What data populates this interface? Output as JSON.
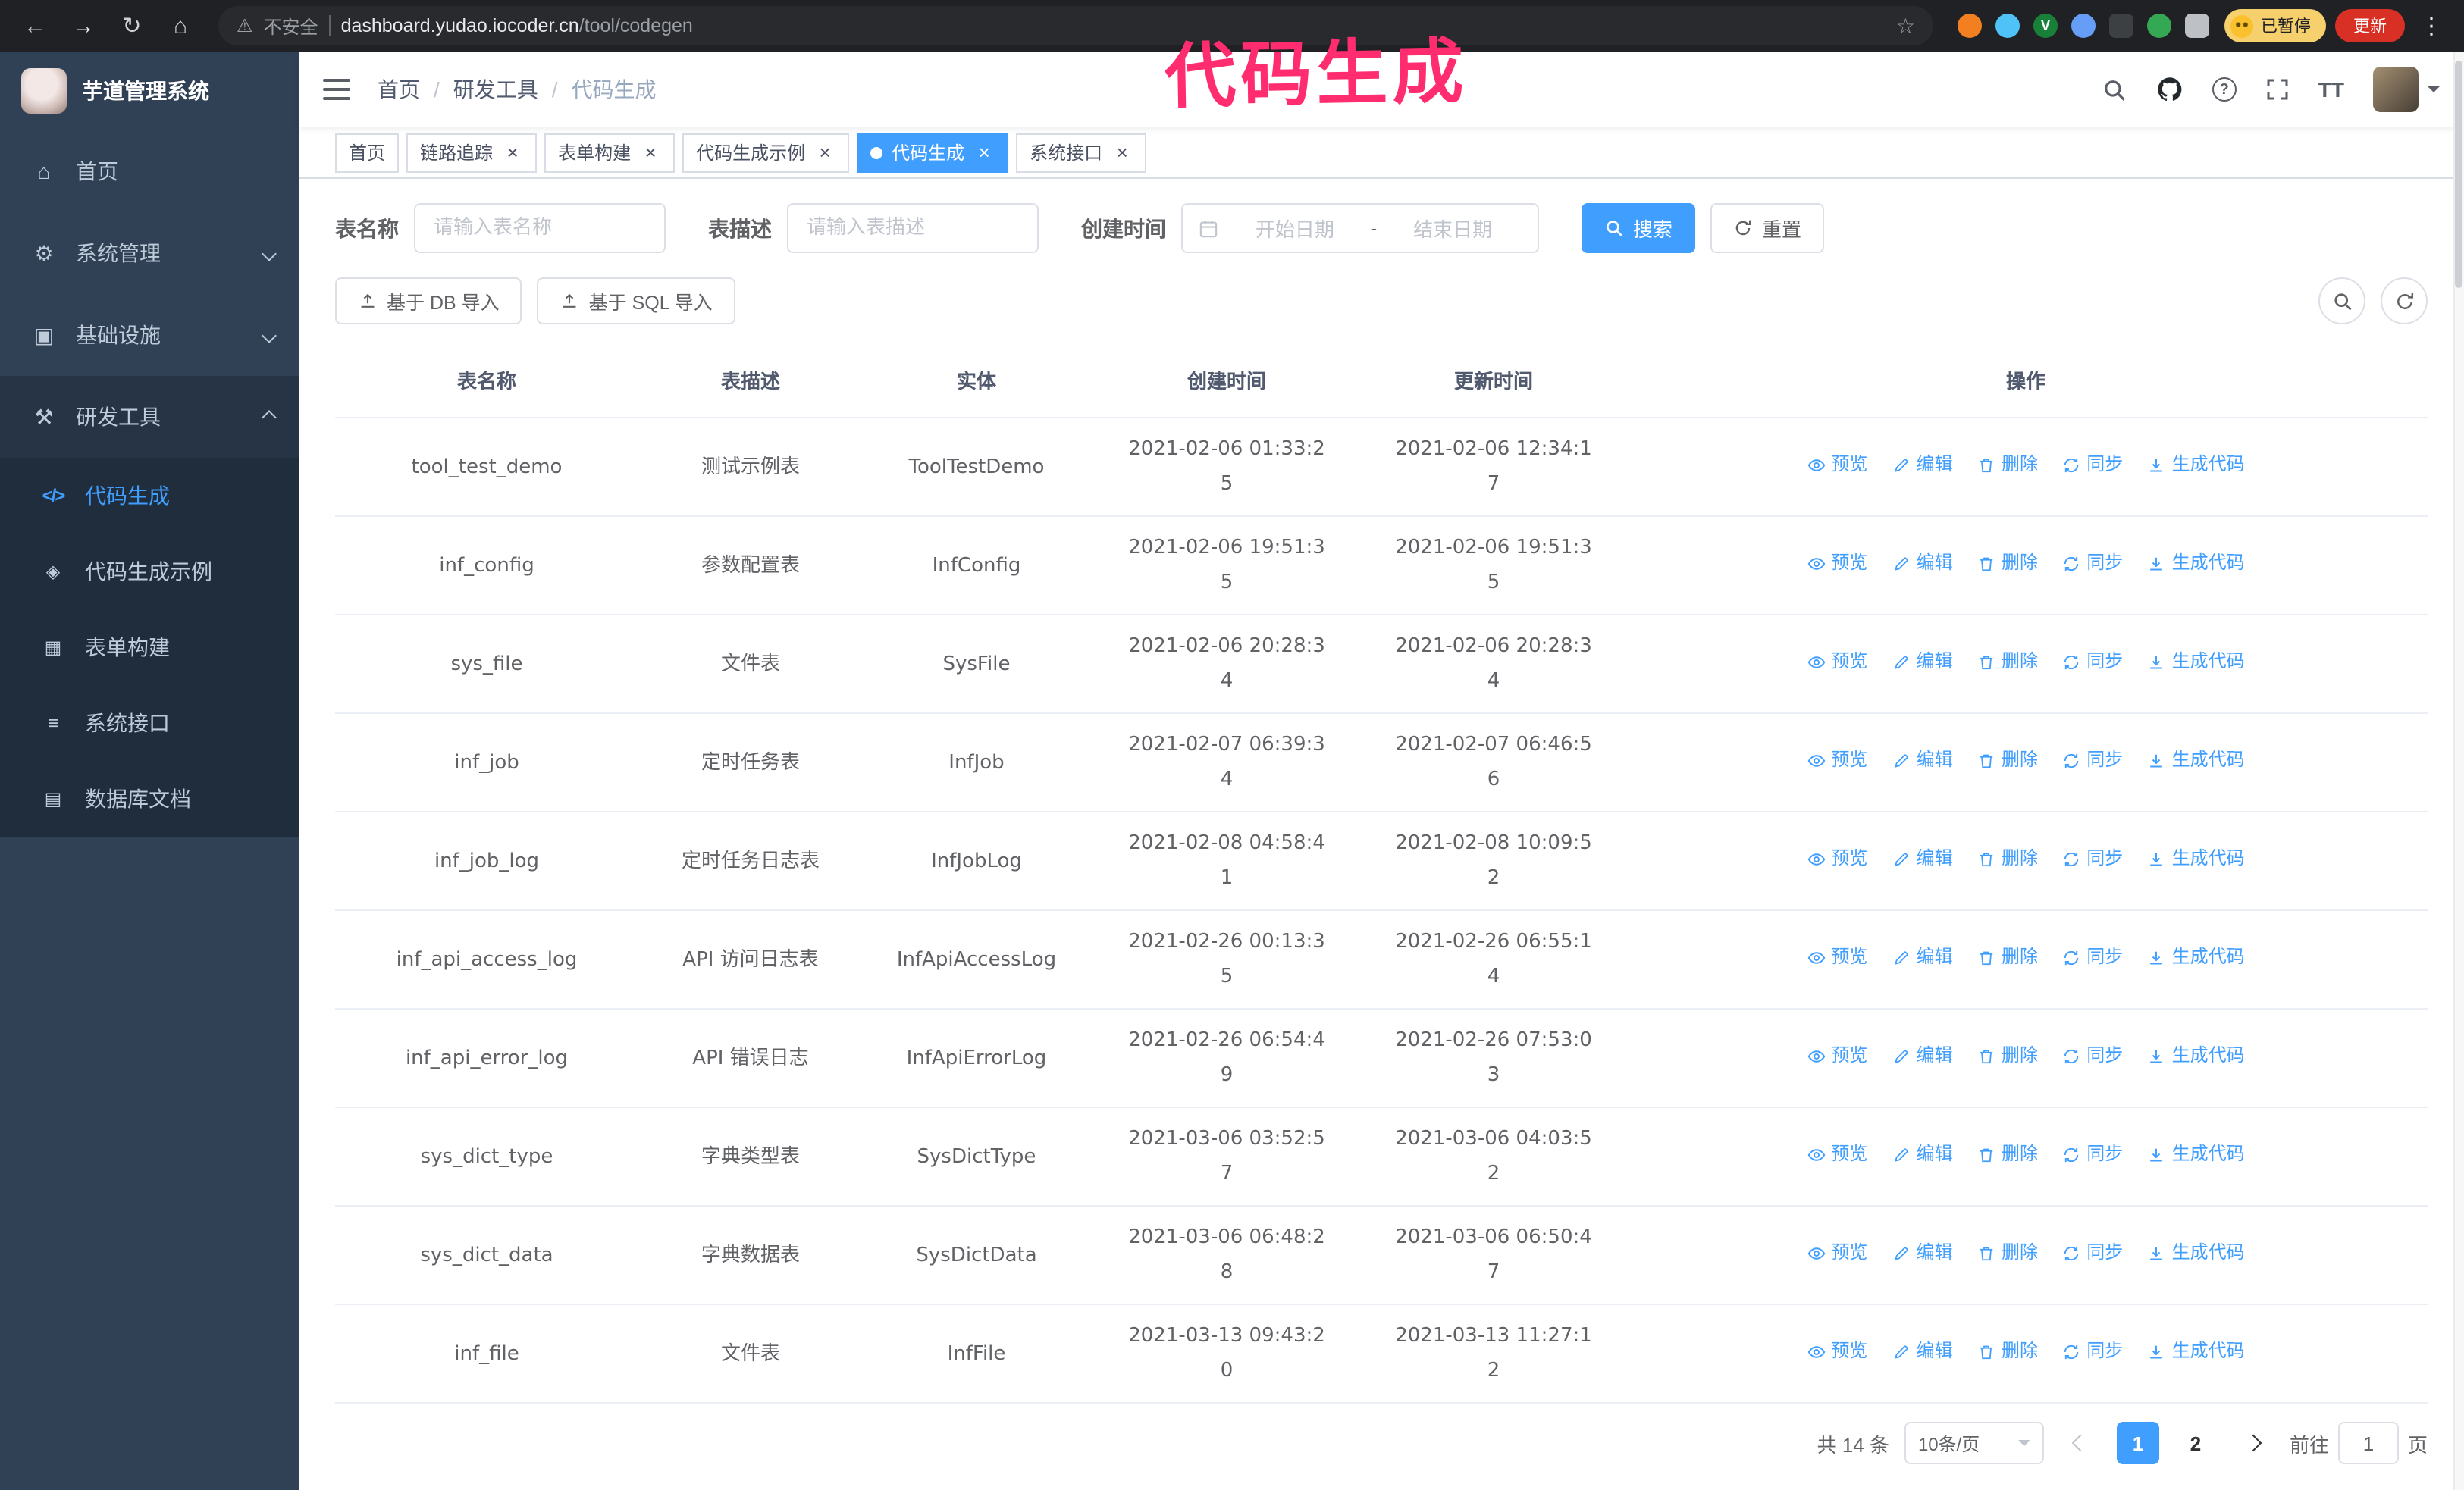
{
  "browser": {
    "security_label": "不安全",
    "url_domain": "dashboard.yudao.iocoder.cn",
    "url_path": "/tool/codegen",
    "paused_badge": "已暂停",
    "update_button": "更新",
    "extension_icons": [
      {
        "name": "extension-orange",
        "color": "#f38020"
      },
      {
        "name": "extension-blue-drop",
        "color": "#4fc3f7"
      },
      {
        "name": "extension-green-check",
        "color": "#188038"
      },
      {
        "name": "extension-people",
        "color": "#669df6"
      },
      {
        "name": "extension-dark",
        "color": "#3c4043"
      },
      {
        "name": "extension-leaf",
        "color": "#34a853"
      },
      {
        "name": "extension-puzzle",
        "color": "#bdc1c6"
      }
    ]
  },
  "icons": {
    "back": "←",
    "forward": "→",
    "reload": "↻",
    "home": "⌂",
    "warning": "⚠",
    "star": "☆",
    "more_vert": "⋮",
    "tab_close": "×",
    "menu_home": "⌂",
    "menu_system": "⚙",
    "menu_infra": "▣",
    "menu_devtools": "⚒",
    "menu_codegen": "</>",
    "menu_example": "◈",
    "menu_form": "▦",
    "menu_api": "≡",
    "menu_dbdoc": "▤",
    "font_size": "TT",
    "extension_check": "V"
  },
  "annotation": {
    "text": "代码生成",
    "color": "#ff2d70"
  },
  "sidebar": {
    "logo_title": "芋道管理系统",
    "items": [
      {
        "label": "首页"
      },
      {
        "label": "系统管理"
      },
      {
        "label": "基础设施"
      },
      {
        "label": "研发工具"
      }
    ],
    "sub_items": [
      {
        "label": "代码生成",
        "active": true
      },
      {
        "label": "代码生成示例"
      },
      {
        "label": "表单构建"
      },
      {
        "label": "系统接口"
      },
      {
        "label": "数据库文档"
      }
    ]
  },
  "breadcrumb": {
    "items": [
      "首页",
      "研发工具",
      "代码生成"
    ],
    "separator": "/"
  },
  "tabs": [
    {
      "label": "首页",
      "closable": false,
      "active": false
    },
    {
      "label": "链路追踪",
      "closable": true,
      "active": false
    },
    {
      "label": "表单构建",
      "closable": true,
      "active": false
    },
    {
      "label": "代码生成示例",
      "closable": true,
      "active": false
    },
    {
      "label": "代码生成",
      "closable": true,
      "active": true
    },
    {
      "label": "系统接口",
      "closable": true,
      "active": false
    }
  ],
  "filters": {
    "table_name_label": "表名称",
    "table_name_placeholder": "请输入表名称",
    "table_desc_label": "表描述",
    "table_desc_placeholder": "请输入表描述",
    "create_time_label": "创建时间",
    "date_start_placeholder": "开始日期",
    "date_separator": "-",
    "date_end_placeholder": "结束日期",
    "search_button": "搜索",
    "reset_button": "重置"
  },
  "toolbar": {
    "import_db_button": "基于 DB 导入",
    "import_sql_button": "基于 SQL 导入"
  },
  "table": {
    "headers": [
      "表名称",
      "表描述",
      "实体",
      "创建时间",
      "更新时间",
      "操作"
    ],
    "action_labels": [
      "预览",
      "编辑",
      "删除",
      "同步",
      "生成代码"
    ],
    "rows": [
      {
        "name": "tool_test_demo",
        "desc": "测试示例表",
        "entity": "ToolTestDemo",
        "create_time": "2021-02-06 01:33:25",
        "update_time": "2021-02-06 12:34:17"
      },
      {
        "name": "inf_config",
        "desc": "参数配置表",
        "entity": "InfConfig",
        "create_time": "2021-02-06 19:51:35",
        "update_time": "2021-02-06 19:51:35"
      },
      {
        "name": "sys_file",
        "desc": "文件表",
        "entity": "SysFile",
        "create_time": "2021-02-06 20:28:34",
        "update_time": "2021-02-06 20:28:34"
      },
      {
        "name": "inf_job",
        "desc": "定时任务表",
        "entity": "InfJob",
        "create_time": "2021-02-07 06:39:34",
        "update_time": "2021-02-07 06:46:56"
      },
      {
        "name": "inf_job_log",
        "desc": "定时任务日志表",
        "entity": "InfJobLog",
        "create_time": "2021-02-08 04:58:41",
        "update_time": "2021-02-08 10:09:52"
      },
      {
        "name": "inf_api_access_log",
        "desc": "API 访问日志表",
        "entity": "InfApiAccessLog",
        "create_time": "2021-02-26 00:13:35",
        "update_time": "2021-02-26 06:55:14"
      },
      {
        "name": "inf_api_error_log",
        "desc": "API 错误日志",
        "entity": "InfApiErrorLog",
        "create_time": "2021-02-26 06:54:49",
        "update_time": "2021-02-26 07:53:03"
      },
      {
        "name": "sys_dict_type",
        "desc": "字典类型表",
        "entity": "SysDictType",
        "create_time": "2021-03-06 03:52:57",
        "update_time": "2021-03-06 04:03:52"
      },
      {
        "name": "sys_dict_data",
        "desc": "字典数据表",
        "entity": "SysDictData",
        "create_time": "2021-03-06 06:48:28",
        "update_time": "2021-03-06 06:50:47"
      },
      {
        "name": "inf_file",
        "desc": "文件表",
        "entity": "InfFile",
        "create_time": "2021-03-13 09:43:20",
        "update_time": "2021-03-13 11:27:12"
      }
    ]
  },
  "pagination": {
    "total_text": "共 14 条",
    "page_size": "10条/页",
    "pages": [
      "1",
      "2"
    ],
    "active_page": "1",
    "goto_label": "前往",
    "goto_value": "1",
    "goto_suffix": "页"
  },
  "colors": {
    "accent": "#409eff",
    "sidebar_bg": "#304156",
    "submenu_bg": "#1f2d3d",
    "active_tab_bg": "#409eff",
    "annotation": "#ff2d70",
    "update_button": "#d93025",
    "paused_badge": "#f6d06c"
  }
}
